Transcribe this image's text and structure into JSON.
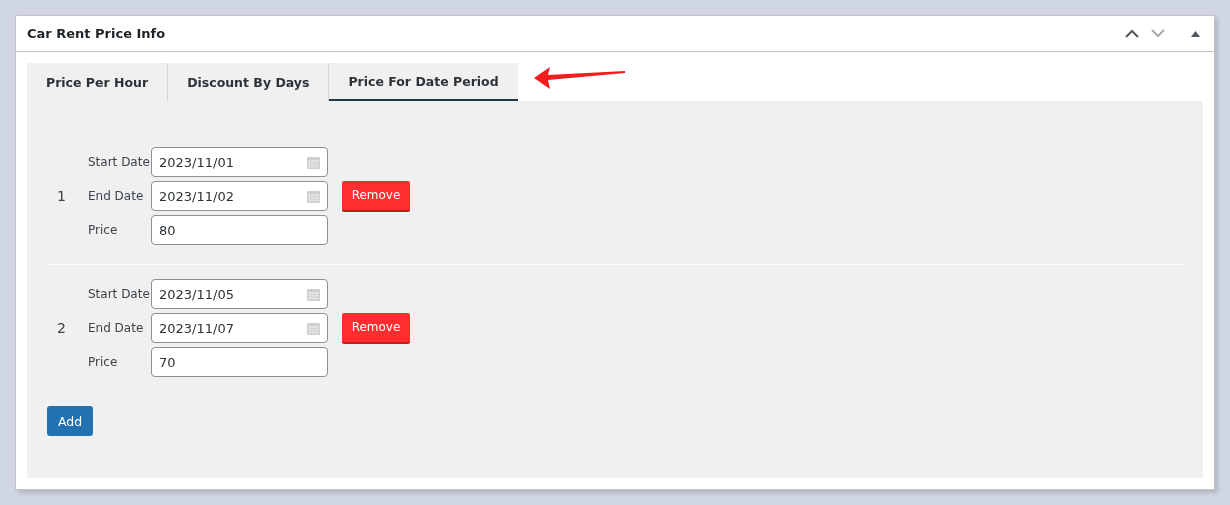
{
  "panel": {
    "title": "Car Rent Price Info"
  },
  "tabs": [
    {
      "label": "Price Per Hour",
      "selected": false
    },
    {
      "label": "Discount By Days",
      "selected": false
    },
    {
      "label": "Price For Date Period",
      "selected": true
    }
  ],
  "periods": [
    {
      "number": "1",
      "fields": [
        {
          "label": "Start Date",
          "value": "2023/11/01",
          "kind": "date"
        },
        {
          "label": "End Date",
          "value": "2023/11/02",
          "kind": "date"
        },
        {
          "label": "Price",
          "value": "80",
          "kind": "text"
        }
      ],
      "remove_button": "Remove"
    },
    {
      "number": "2",
      "fields": [
        {
          "label": "Start Date",
          "value": "2023/11/05",
          "kind": "date"
        },
        {
          "label": "End Date",
          "value": "2023/11/07",
          "kind": "date"
        },
        {
          "label": "Price",
          "value": "70",
          "kind": "text"
        }
      ],
      "remove_button": "Remove"
    }
  ],
  "add_button": "Add"
}
